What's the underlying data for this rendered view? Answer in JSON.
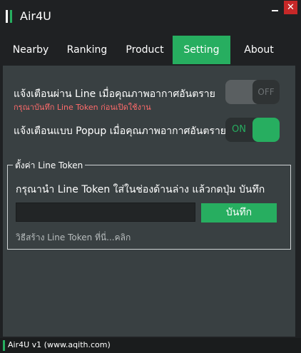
{
  "window": {
    "title": "Air4U"
  },
  "tabs": [
    {
      "label": "Nearby"
    },
    {
      "label": "Ranking"
    },
    {
      "label": "Product"
    },
    {
      "label": "Setting"
    },
    {
      "label": "About"
    }
  ],
  "active_tab": "Setting",
  "settings": {
    "line_alert": {
      "label": "แจ้งเตือนผ่าน Line เมื่อคุณภาพอากาศอันตราย",
      "warning": "กรุณาบันทึก Line Token ก่อนเปิดใช้งาน",
      "state": "OFF"
    },
    "popup_alert": {
      "label": "แจ้งเตือนแบบ Popup เมื่อคุณภาพอากาศอันตราย",
      "state": "ON"
    }
  },
  "line_token": {
    "legend": "ตั้งค่า Line Token",
    "instruction": "กรุณานำ Line Token ใส่ในช่องด้านล่าง แล้วกดปุ่ม บันทึก",
    "value": "",
    "save_label": "บันทึก",
    "howto_link": "วิธีสร้าง Line Token ที่นี่...คลิก"
  },
  "status": {
    "text": "Air4U v1 (www.aqith.com)"
  },
  "colors": {
    "accent": "#27ae60",
    "panel": "#394042",
    "background": "#1f2123",
    "warning": "#ff6b6b",
    "close": "#c62828"
  }
}
